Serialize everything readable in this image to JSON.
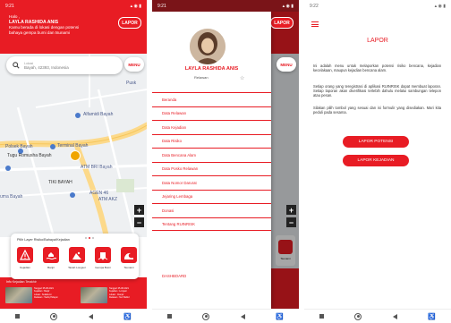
{
  "screen1": {
    "status_time": "9:21",
    "greeting": "Halo ,",
    "user_name": "LAYLA RASHIDA ANIS",
    "status_line1": "Kamu berada di lokasi dengan potensi",
    "status_line2": "bahaya gempa bumi dan tsunami",
    "lapor_label": "LAPOR",
    "search_label": "Lokasi",
    "search_value": "Bayah, 42393, Indonesia",
    "menu_label": "MENU",
    "map_labels": {
      "pusk": "Pusk",
      "alfamidi": "Alfamidi Bayah",
      "polsek": "Polsek Bayah",
      "terminal": "Terminal Bayah",
      "tugu": "Tugu Romusha Bayah",
      "atm_bri": "ATM BRI Bayah",
      "tiki": "TIKI BAYAH",
      "agen46": "AGEN 46",
      "atm_akz": "ATM AKZ",
      "uma": "uma Bayah"
    },
    "hazard_title": "Pilih Layer Risiko/Bahaya/Kejadian",
    "hazards": [
      {
        "label": "Kejadian",
        "icon": "warning-icon"
      },
      {
        "label": "Banjir",
        "icon": "flood-icon"
      },
      {
        "label": "Tanah Longsor",
        "icon": "landslide-icon"
      },
      {
        "label": "Gempa Bumi",
        "icon": "earthquake-icon"
      },
      {
        "label": "Tsunami",
        "icon": "tsunami-icon"
      }
    ],
    "news_title": "Info Kejadian Terakhir",
    "news": [
      {
        "l1": "Tanggal: 05-08-2021",
        "l2": "Kejadian : Banjir",
        "l3": "Lokasi : Sukabumi",
        "l4": "Relawan : Taufiq Hidayat"
      },
      {
        "l1": "Tanggal: 05-08-2021",
        "l2": "Kejadian : Longsor",
        "l3": "Lokasi : Cianjur",
        "l4": "Relawan : Nur Wahid"
      }
    ],
    "accent": "#e81c24"
  },
  "screen2": {
    "status_time": "9:21",
    "lapor_label": "LAPOR",
    "menu_label": "MENU",
    "profile_name": "LAYLA RASHIDA ANIS",
    "profile_role": "Relawan",
    "menu_items": [
      "Beranda",
      "Data Relawan",
      "Data Kejadian",
      "Data Risiko",
      "Data Bencana Alam",
      "Data Posko Relawan",
      "Data Nomor Darurat",
      "Jejaring Lembaga",
      "Donasi",
      "Tentang RUINRISK"
    ],
    "dashboard_label": "DASHBOARD",
    "peek_label": "Tsunami"
  },
  "screen3": {
    "status_time": "9:22",
    "title": "LAPOR",
    "para1": "Ini adalah menu untuk melaporkan potensi risiko bencana, kejadian kecelakaan, maupun kejadian bencana alam.",
    "para2": "Setiap orang yang teregistrasi di aplikasi RUINRISK dapat membuat laporan. Setiap laporan akan diverifikasi terlebih dahulu melalui sambungan telepon atau pesan.",
    "para3": "Silakan pilih tombol yang sesuai dan isi formulir yang disediakan. Mari kita peduli pada sesama.",
    "btn_potensi": "LAPOR POTENSI",
    "btn_kejadian": "LAPOR KEJADIAN"
  }
}
